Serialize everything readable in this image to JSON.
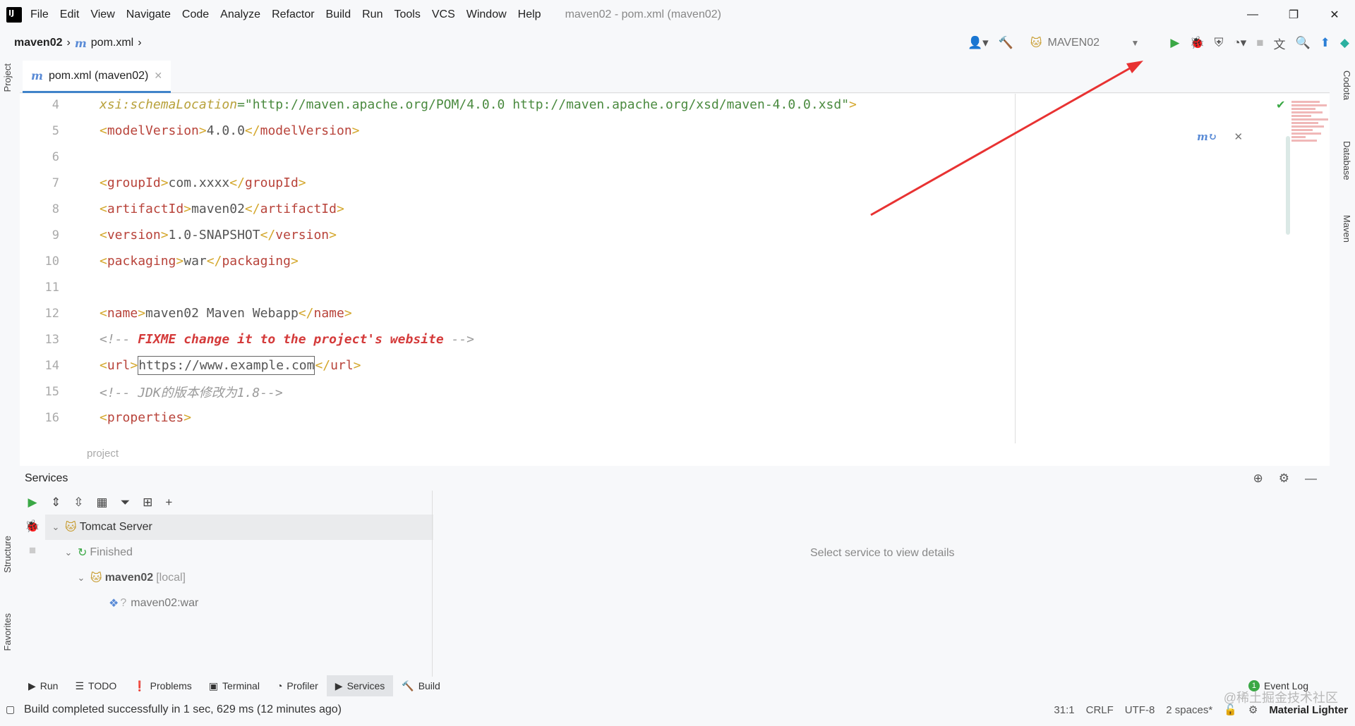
{
  "menu": {
    "items": [
      "File",
      "Edit",
      "View",
      "Navigate",
      "Code",
      "Analyze",
      "Refactor",
      "Build",
      "Run",
      "Tools",
      "VCS",
      "Window",
      "Help"
    ],
    "window_title": "maven02 - pom.xml (maven02)"
  },
  "nav": {
    "project": "maven02",
    "file": "pom.xml",
    "run_config": "MAVEN02"
  },
  "editor": {
    "tab_label": "pom.xml (maven02)",
    "lines": [
      {
        "n": "4"
      },
      {
        "n": "5"
      },
      {
        "n": "6"
      },
      {
        "n": "7"
      },
      {
        "n": "8"
      },
      {
        "n": "9"
      },
      {
        "n": "10"
      },
      {
        "n": "11"
      },
      {
        "n": "12"
      },
      {
        "n": "13"
      },
      {
        "n": "14"
      },
      {
        "n": "15"
      },
      {
        "n": "16"
      }
    ],
    "schema_attr": "xsi:schemaLocation",
    "schema_value": "\"http://maven.apache.org/POM/4.0.0 http://maven.apache.org/xsd/maven-4.0.0.xsd\"",
    "model_version": "4.0.0",
    "group_id": "com.xxxx",
    "artifact_id": "maven02",
    "version": "1.0-SNAPSHOT",
    "packaging": "war",
    "name": "maven02 Maven Webapp",
    "comment_todo": "FIXME change it to the project's website",
    "url": "https://www.example.com",
    "comment_jdk": "JDK的版本修改为1.8",
    "breadcrumb": "project"
  },
  "left_tabs": {
    "project": "Project",
    "structure": "Structure",
    "favorites": "Favorites"
  },
  "right_tabs": {
    "codota": "Codota",
    "database": "Database",
    "maven": "Maven"
  },
  "services": {
    "title": "Services",
    "tree": {
      "server": "Tomcat Server",
      "status": "Finished",
      "deployment": "maven02",
      "deployment_scope": "[local]",
      "artifact": "maven02:war"
    },
    "details_placeholder": "Select service to view details"
  },
  "bottom_tabs": [
    "Run",
    "TODO",
    "Problems",
    "Terminal",
    "Profiler",
    "Services",
    "Build"
  ],
  "event_log": {
    "count": "1",
    "label": "Event Log"
  },
  "status": {
    "message": "Build completed successfully in 1 sec, 629 ms (12 minutes ago)",
    "position": "31:1",
    "line_sep": "CRLF",
    "encoding": "UTF-8",
    "indent": "2 spaces*",
    "theme": "Material Lighter"
  },
  "watermark": "@稀土掘金技术社区",
  "colors": {
    "accent": "#4083c9",
    "run_green": "#3aa845",
    "arrow_red": "#e83232"
  }
}
